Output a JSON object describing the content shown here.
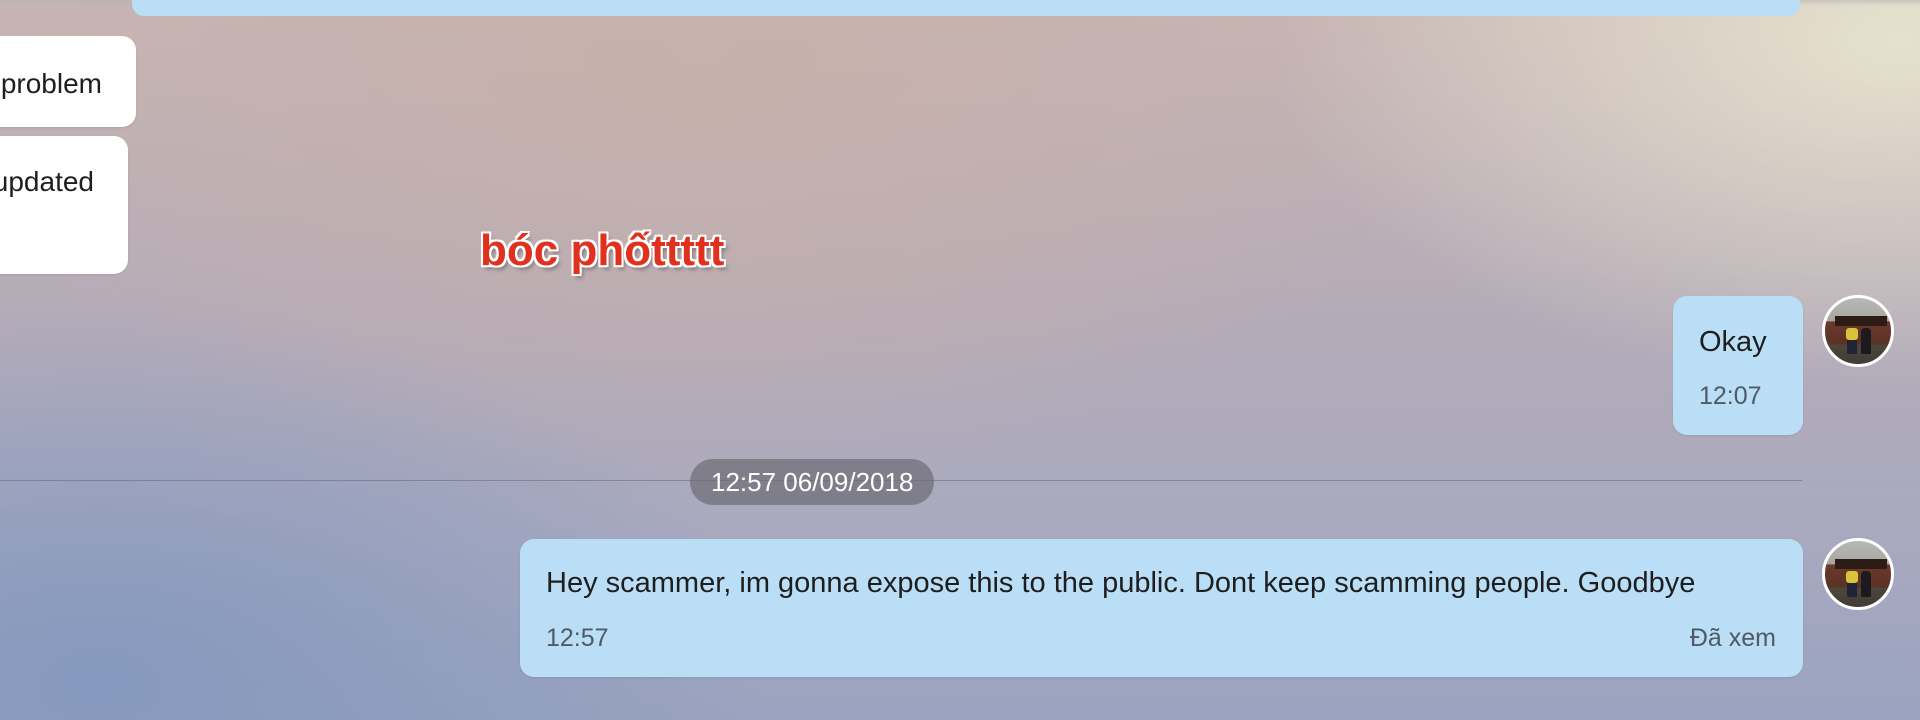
{
  "messages": {
    "incoming": [
      {
        "text": "problem"
      },
      {
        "text": "updated"
      }
    ],
    "outgoing_1": {
      "text": "Okay",
      "time": "12:07"
    },
    "date_separator": "12:57 06/09/2018",
    "outgoing_2": {
      "text": "Hey scammer, im gonna expose this to the public. Dont keep scamming people. Goodbye",
      "time": "12:57",
      "status": "Đã xem"
    }
  },
  "overlay": {
    "text": "bóc phốttttt",
    "color": "#e0301e"
  },
  "colors": {
    "outgoing_bubble": "#b9def6",
    "incoming_bubble": "#ffffff",
    "date_pill": "#6e6e76"
  }
}
